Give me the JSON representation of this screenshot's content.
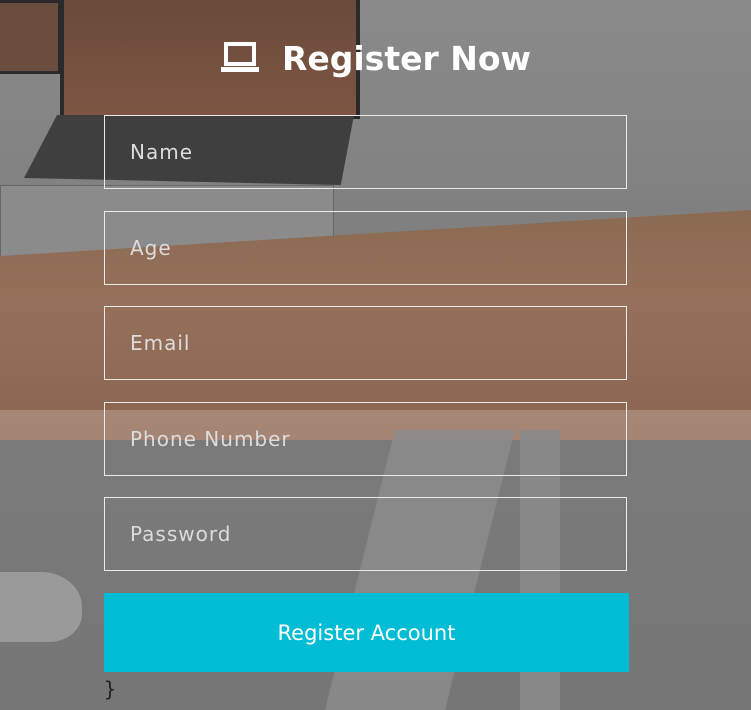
{
  "header": {
    "title": "Register Now",
    "icon": "laptop-icon"
  },
  "form": {
    "fields": [
      {
        "placeholder": "Name",
        "value": ""
      },
      {
        "placeholder": "Age",
        "value": ""
      },
      {
        "placeholder": "Email",
        "value": ""
      },
      {
        "placeholder": "Phone Number",
        "value": ""
      },
      {
        "placeholder": "Password",
        "value": ""
      }
    ],
    "submit_label": "Register Account"
  },
  "stray_text": "}",
  "colors": {
    "accent": "#00bcd4",
    "field_border": "#eaeaea",
    "title_text": "#ffffff"
  }
}
